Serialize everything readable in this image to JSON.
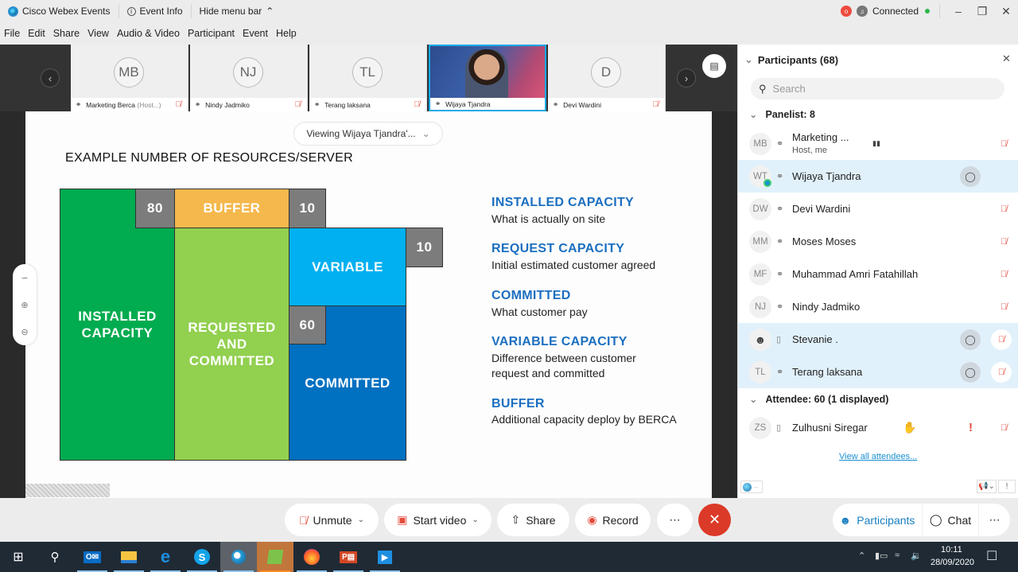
{
  "titlebar": {
    "app_name": "Cisco Webex Events",
    "event_info": "Event Info",
    "hide_menu": "Hide menu bar",
    "status": "Connected",
    "status_color": "#2eb84b"
  },
  "menu": [
    "File",
    "Edit",
    "Share",
    "View",
    "Audio & Video",
    "Participant",
    "Event",
    "Help"
  ],
  "filmstrip": [
    {
      "initials": "MB",
      "name": "Marketing Berca",
      "suffix": "(Host...)",
      "muted": true
    },
    {
      "initials": "NJ",
      "name": "Nindy Jadmiko",
      "muted": true
    },
    {
      "initials": "TL",
      "name": "Terang laksana",
      "muted": true
    },
    {
      "initials": "",
      "name": "Wijaya Tjandra",
      "video": true,
      "active": true,
      "muted": false
    },
    {
      "initials": "D",
      "name": "Devi Wardini",
      "muted": true
    }
  ],
  "viewing_label": "Viewing Wijaya Tjandra'...",
  "slide": {
    "title": "EXAMPLE NUMBER OF RESOURCES/SERVER",
    "blocks": {
      "installed": "INSTALLED CAPACITY",
      "requested": "REQUESTED AND COMMITTED",
      "buffer": "BUFFER",
      "variable": "VARIABLE",
      "committed": "COMMITTED",
      "num_80": "80",
      "num_10a": "10",
      "num_10b": "10",
      "num_60": "60"
    },
    "colors": {
      "installed": "#00ac4f",
      "requested": "#92d050",
      "buffer": "#f5b84c",
      "variable": "#00b0f0",
      "committed": "#0070c0",
      "number": "#7c7c7c",
      "heading": "#1b6fc0"
    },
    "definitions": [
      {
        "heading": "INSTALLED CAPACITY",
        "text": "What is actually on site"
      },
      {
        "heading": "REQUEST CAPACITY",
        "text": "Initial estimated customer agreed"
      },
      {
        "heading": "COMMITTED",
        "text": "What customer pay"
      },
      {
        "heading": "VARIABLE CAPACITY",
        "text": "Difference between customer request and committed"
      },
      {
        "heading": "BUFFER",
        "text": "Additional capacity deploy by BERCA"
      }
    ]
  },
  "panel": {
    "title": "Participants (68)",
    "search_placeholder": "Search",
    "panelist_header": "Panelist: 8",
    "panelists": [
      {
        "initials": "MB",
        "name": "Marketing ...",
        "sub": "Host, me",
        "device": "headset",
        "muted": true
      },
      {
        "initials": "WT",
        "name": "Wijaya Tjandra",
        "device": "headset",
        "chat": true,
        "highlight": true
      },
      {
        "initials": "DW",
        "name": "Devi Wardini",
        "device": "headset",
        "muted": true
      },
      {
        "initials": "MM",
        "name": "Moses Moses",
        "device": "headset",
        "muted": true
      },
      {
        "initials": "MF",
        "name": "Muhammad Amri Fatahillah",
        "device": "headset",
        "muted": true
      },
      {
        "initials": "NJ",
        "name": "Nindy Jadmiko",
        "device": "headset",
        "muted": true
      },
      {
        "initials": "",
        "name": "Stevanie .",
        "device": "phone",
        "chat": true,
        "muted": true,
        "highlight": true
      },
      {
        "initials": "TL",
        "name": "Terang laksana",
        "device": "headset",
        "chat": true,
        "muted": true,
        "highlight": true
      }
    ],
    "attendee_header": "Attendee: 60 (1 displayed)",
    "attendees": [
      {
        "initials": "ZS",
        "name": "Zulhusni Siregar",
        "device": "phone",
        "hand_raised": true,
        "alert": true,
        "muted": true
      }
    ],
    "view_all": "View all attendees..."
  },
  "controls": {
    "unmute": "Unmute",
    "start_video": "Start video",
    "share": "Share",
    "record": "Record",
    "participants": "Participants",
    "chat": "Chat"
  },
  "taskbar": {
    "apps": [
      "Start",
      "Search",
      "Outlook",
      "File Explorer",
      "Edge",
      "Skype",
      "Webex",
      "App",
      "Firefox",
      "PowerPoint",
      "Video"
    ],
    "time": "10:11",
    "date": "28/09/2020"
  }
}
